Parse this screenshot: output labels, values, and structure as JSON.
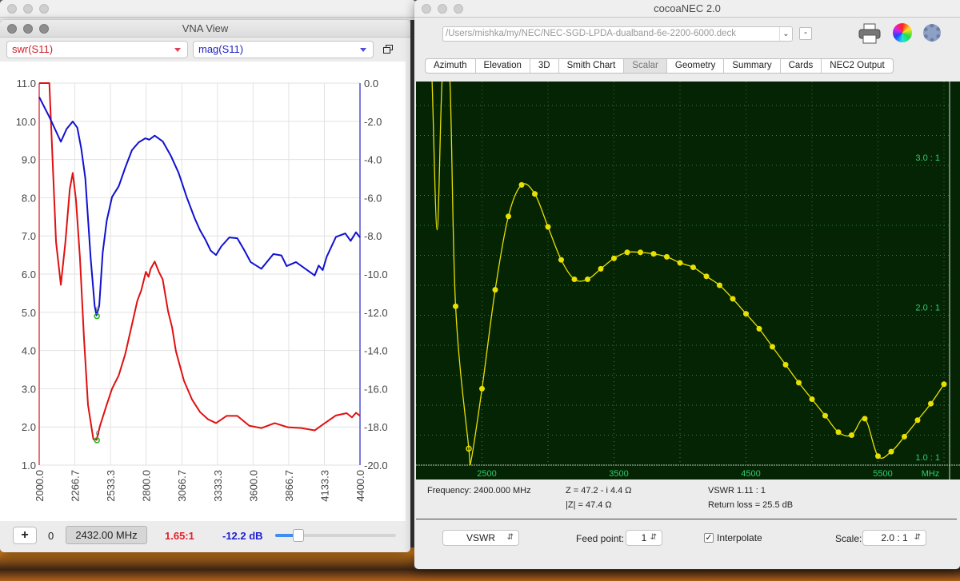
{
  "background_window": {
    "title": ""
  },
  "vna": {
    "title": "VNA View",
    "left_select": {
      "value": "swr(S11)",
      "color": "#d0202a"
    },
    "right_select": {
      "value": "mag(S11)",
      "color": "#2020c0"
    },
    "footer": {
      "add_label": "+",
      "marker_index": "0",
      "frequency": "2432.00 MHz",
      "swr_readout": "1.65:1",
      "mag_readout": "-12.2 dB",
      "slider_fraction": 0.19
    }
  },
  "nec": {
    "title": "cocoaNEC 2.0",
    "deck_path": "/Users/mishka/my/NEC/NEC-SGD-LPDA-dualband-6e-2200-6000.deck",
    "minus_label": "-",
    "icons": [
      "printer-icon",
      "color-wheel-icon",
      "gear-icon"
    ],
    "tabs": [
      {
        "label": "Azimuth"
      },
      {
        "label": "Elevation"
      },
      {
        "label": "3D"
      },
      {
        "label": "Smith Chart"
      },
      {
        "label": "Scalar",
        "active": true
      },
      {
        "label": "Geometry"
      },
      {
        "label": "Summary"
      },
      {
        "label": "Cards"
      },
      {
        "label": "NEC2 Output"
      }
    ],
    "info": {
      "frequency": "Frequency: 2400.000 MHz",
      "z": "Z = 47.2 - i 4.4 Ω",
      "zmag": "|Z| = 47.4 Ω",
      "vswr": "VSWR 1.11 : 1",
      "return_loss": "Return loss = 25.5 dB"
    },
    "controls": {
      "mode": "VSWR",
      "feed_label": "Feed point:",
      "feed_value": "1",
      "interpolate_label": "Interpolate",
      "interpolate_checked": true,
      "scale_label": "Scale:",
      "scale_value": "2.0 : 1"
    }
  },
  "chart_data": [
    {
      "type": "line",
      "xlabel": "",
      "ylabel": "",
      "xlim": [
        2000,
        4400
      ],
      "ylim_left": [
        1.0,
        11.0
      ],
      "ylim_right": [
        -20.0,
        0.0
      ],
      "grid": true,
      "x_ticks": [
        "2000.0",
        "2266.7",
        "2533.3",
        "2800.0",
        "3066.7",
        "3333.3",
        "3600.0",
        "3866.7",
        "4133.3",
        "4400.0"
      ],
      "y_ticks_left": [
        "11.0",
        "10.0",
        "9.0",
        "8.0",
        "7.0",
        "6.0",
        "5.0",
        "4.0",
        "3.0",
        "2.0",
        "1.0"
      ],
      "y_ticks_right": [
        "0.0",
        "-2.0",
        "-4.0",
        "-6.0",
        "-8.0",
        "-10.0",
        "-12.0",
        "-14.0",
        "-16.0",
        "-18.0",
        "-20.0"
      ],
      "series": [
        {
          "axis": "left",
          "color": "#e01010",
          "points": [
            [
              2000,
              11
            ],
            [
              2076,
              11
            ],
            [
              2106,
              8.5
            ],
            [
              2126,
              6.84
            ],
            [
              2162,
              5.72
            ],
            [
              2196,
              6.84
            ],
            [
              2229,
              8.23
            ],
            [
              2251,
              8.65
            ],
            [
              2275,
              7.95
            ],
            [
              2305,
              6.42
            ],
            [
              2335,
              4.33
            ],
            [
              2365,
              2.58
            ],
            [
              2405,
              1.68
            ],
            [
              2429,
              1.66
            ],
            [
              2455,
              2.03
            ],
            [
              2505,
              2.58
            ],
            [
              2545,
              3.0
            ],
            [
              2595,
              3.35
            ],
            [
              2644,
              3.91
            ],
            [
              2694,
              4.68
            ],
            [
              2734,
              5.3
            ],
            [
              2764,
              5.58
            ],
            [
              2798,
              6.06
            ],
            [
              2818,
              5.93
            ],
            [
              2834,
              6.14
            ],
            [
              2864,
              6.33
            ],
            [
              2894,
              6.07
            ],
            [
              2924,
              5.86
            ],
            [
              2964,
              5.03
            ],
            [
              2994,
              4.61
            ],
            [
              3023,
              3.98
            ],
            [
              3083,
              3.21
            ],
            [
              3143,
              2.72
            ],
            [
              3203,
              2.39
            ],
            [
              3263,
              2.2
            ],
            [
              3323,
              2.1
            ],
            [
              3403,
              2.29
            ],
            [
              3482,
              2.29
            ],
            [
              3572,
              2.03
            ],
            [
              3662,
              1.97
            ],
            [
              3762,
              2.1
            ],
            [
              3861,
              1.99
            ],
            [
              3961,
              1.97
            ],
            [
              4061,
              1.91
            ],
            [
              4121,
              2.06
            ],
            [
              4220,
              2.3
            ],
            [
              4300,
              2.36
            ],
            [
              4340,
              2.25
            ],
            [
              4370,
              2.37
            ],
            [
              4400,
              2.29
            ]
          ]
        },
        {
          "axis": "right",
          "color": "#1010d0",
          "points": [
            [
              2000,
              -0.73
            ],
            [
              2076,
              -1.77
            ],
            [
              2162,
              -3.07
            ],
            [
              2205,
              -2.4
            ],
            [
              2251,
              -2.01
            ],
            [
              2285,
              -2.33
            ],
            [
              2315,
              -3.44
            ],
            [
              2345,
              -4.98
            ],
            [
              2385,
              -9.16
            ],
            [
              2415,
              -11.67
            ],
            [
              2429,
              -12.16
            ],
            [
              2449,
              -11.67
            ],
            [
              2475,
              -8.88
            ],
            [
              2505,
              -7.21
            ],
            [
              2545,
              -5.96
            ],
            [
              2595,
              -5.4
            ],
            [
              2644,
              -4.42
            ],
            [
              2694,
              -3.51
            ],
            [
              2744,
              -3.1
            ],
            [
              2794,
              -2.89
            ],
            [
              2824,
              -2.96
            ],
            [
              2864,
              -2.75
            ],
            [
              2924,
              -3.05
            ],
            [
              2984,
              -3.79
            ],
            [
              3043,
              -4.7
            ],
            [
              3103,
              -5.96
            ],
            [
              3163,
              -7.07
            ],
            [
              3203,
              -7.7
            ],
            [
              3243,
              -8.19
            ],
            [
              3283,
              -8.77
            ],
            [
              3323,
              -9.0
            ],
            [
              3363,
              -8.54
            ],
            [
              3422,
              -8.08
            ],
            [
              3482,
              -8.12
            ],
            [
              3532,
              -8.72
            ],
            [
              3582,
              -9.37
            ],
            [
              3662,
              -9.72
            ],
            [
              3752,
              -8.95
            ],
            [
              3812,
              -9.02
            ],
            [
              3851,
              -9.58
            ],
            [
              3921,
              -9.37
            ],
            [
              3991,
              -9.72
            ],
            [
              4061,
              -10.07
            ],
            [
              4091,
              -9.55
            ],
            [
              4121,
              -9.79
            ],
            [
              4151,
              -9.09
            ],
            [
              4220,
              -8.05
            ],
            [
              4290,
              -7.87
            ],
            [
              4330,
              -8.26
            ],
            [
              4370,
              -7.81
            ],
            [
              4400,
              -8.08
            ]
          ]
        }
      ],
      "markers": [
        {
          "label": "0",
          "x": 2432,
          "y": 1.65,
          "axis": "left",
          "color": "#20b020"
        },
        {
          "label": "0",
          "x": 2432,
          "y": -12.2,
          "axis": "right",
          "color": "#20b020"
        }
      ]
    },
    {
      "type": "line",
      "xlabel": "",
      "ylabel": "",
      "xlim": [
        2000,
        6000
      ],
      "ylim": [
        1.0,
        3.55
      ],
      "grid": true,
      "x_unit": "MHz",
      "x_ticks": [
        2500,
        3500,
        4500,
        5500
      ],
      "y_labels": [
        {
          "value": 3.0,
          "text": "3.0 : 1"
        },
        {
          "value": 2.0,
          "text": "2.0 : 1"
        },
        {
          "value": 1.0,
          "text": "1.0 : 1"
        }
      ],
      "color": "#e8e000",
      "background": "#042404",
      "curve_offscale": [
        [
          2120,
          3.6
        ],
        [
          2160,
          2.57
        ],
        [
          2200,
          3.6
        ],
        [
          2255,
          3.6
        ]
      ],
      "points": [
        [
          2300,
          2.06
        ],
        [
          2400,
          1.11
        ],
        [
          2500,
          1.51
        ],
        [
          2600,
          2.17
        ],
        [
          2700,
          2.66
        ],
        [
          2800,
          2.87
        ],
        [
          2900,
          2.81
        ],
        [
          3000,
          2.59
        ],
        [
          3100,
          2.37
        ],
        [
          3200,
          2.24
        ],
        [
          3300,
          2.24
        ],
        [
          3400,
          2.31
        ],
        [
          3500,
          2.38
        ],
        [
          3600,
          2.42
        ],
        [
          3700,
          2.42
        ],
        [
          3800,
          2.41
        ],
        [
          3900,
          2.39
        ],
        [
          4000,
          2.35
        ],
        [
          4100,
          2.32
        ],
        [
          4200,
          2.26
        ],
        [
          4300,
          2.2
        ],
        [
          4400,
          2.11
        ],
        [
          4500,
          2.01
        ],
        [
          4600,
          1.91
        ],
        [
          4700,
          1.79
        ],
        [
          4800,
          1.67
        ],
        [
          4900,
          1.55
        ],
        [
          5000,
          1.44
        ],
        [
          5100,
          1.33
        ],
        [
          5200,
          1.22
        ],
        [
          5300,
          1.2
        ],
        [
          5400,
          1.31
        ],
        [
          5500,
          1.06
        ],
        [
          5600,
          1.09
        ],
        [
          5700,
          1.19
        ],
        [
          5800,
          1.3
        ],
        [
          5900,
          1.41
        ],
        [
          6000,
          1.54
        ]
      ],
      "selected_point": [
        2400,
        1.11
      ]
    }
  ]
}
